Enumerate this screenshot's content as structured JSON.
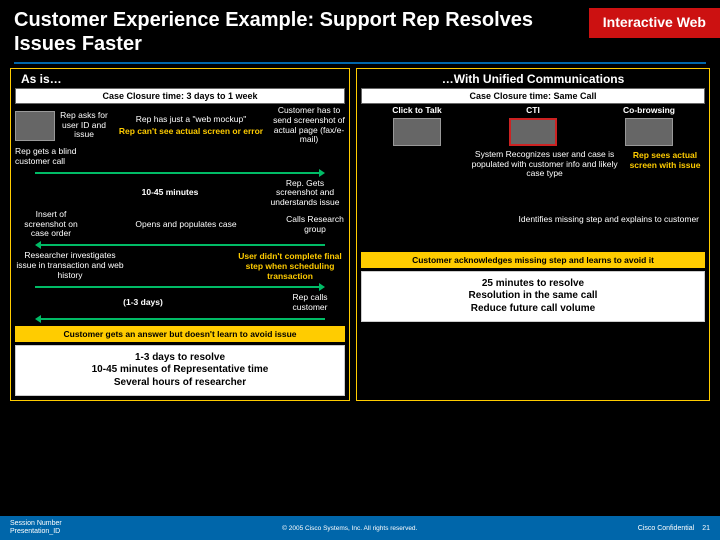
{
  "header": {
    "title": "Customer Experience Example: Support Rep Resolves Issues Faster",
    "badge": "Interactive Web"
  },
  "left": {
    "heading": "As is…",
    "closure": "Case Closure time: 3 days to 1 week",
    "rep_blind": "Rep gets a blind customer call",
    "asks": "Rep asks for user ID and issue",
    "mockup": "Rep has just a \"web mockup\"",
    "cant_see": "Rep can't see actual screen or error",
    "cust_send": "Customer has to send screenshot of actual page (fax/e-mail)",
    "mins": "10-45 minutes",
    "rep_gets": "Rep. Gets screenshot and understands issue",
    "insert": "Insert of screenshot on case order",
    "opens": "Opens and populates case",
    "calls": "Calls Research group",
    "researcher": "Researcher investigates issue in transaction and web history",
    "user_didnt": "User didn't complete final step when scheduling transaction",
    "days": "(1-3 days)",
    "rep_calls": "Rep calls customer",
    "answer": "Customer gets an answer but doesn't learn to avoid issue",
    "summary": "1-3 days to resolve\n10-45 minutes of Representative time\nSeveral hours of researcher"
  },
  "right": {
    "heading": "…With Unified Communications",
    "closure": "Case Closure time: Same Call",
    "click": "Click to Talk",
    "cti": "CTI",
    "cobrowse": "Co-browsing",
    "sys": "System Recognizes user and case is populated with customer info and likely case type",
    "rep_sees": "Rep sees actual screen with issue",
    "identifies": "Identifies missing step and explains to customer",
    "ack": "Customer acknowledges missing step and learns to avoid it",
    "summary": "25 minutes to resolve\nResolution in the same call\nReduce future call volume"
  },
  "footer": {
    "left": "Session Number\nPresentation_ID",
    "mid": "© 2005 Cisco Systems, Inc. All rights reserved.",
    "conf": "Cisco Confidential",
    "page": "21"
  }
}
